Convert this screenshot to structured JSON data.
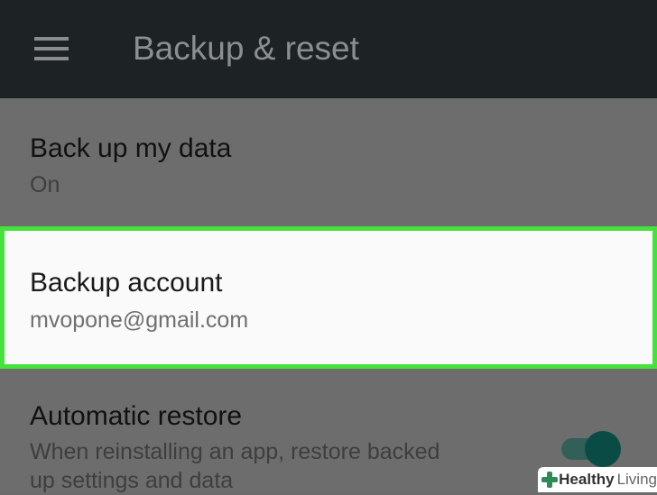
{
  "header": {
    "title": "Backup & reset",
    "menu_icon": "hamburger-menu-icon"
  },
  "settings": {
    "backup_data": {
      "title": "Back up my data",
      "summary": "On"
    },
    "backup_account": {
      "title": "Backup account",
      "summary": "mvopone@gmail.com"
    },
    "automatic_restore": {
      "title": "Automatic restore",
      "summary_line1": "When reinstalling an app, restore backed",
      "summary_line2": "up settings and data",
      "toggle_on": true
    }
  },
  "watermark": {
    "brand_bold": "Healthy",
    "brand_light": "Living",
    "icon": "plus-cross-icon"
  },
  "colors": {
    "appbar": "#1d2224",
    "highlight_border": "#44e23a",
    "toggle_thumb": "#0b4b45",
    "toggle_track": "#325f57"
  }
}
